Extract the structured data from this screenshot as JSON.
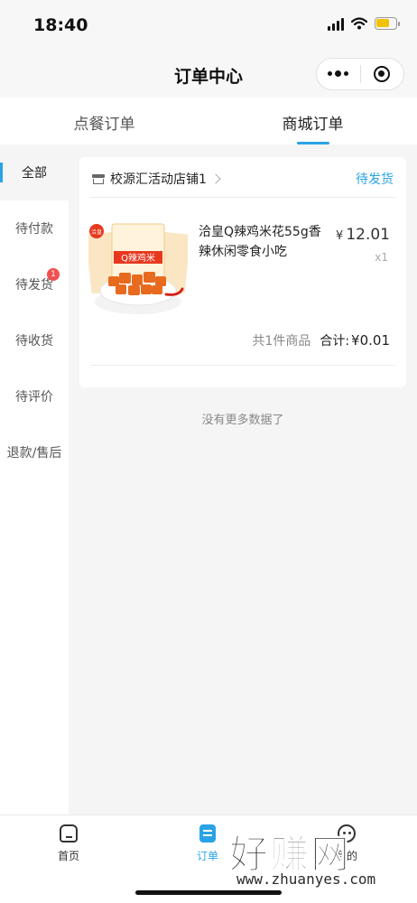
{
  "status_bar": {
    "time": "18:40"
  },
  "nav": {
    "title": "订单中心",
    "more_icon": "more-dots-icon",
    "close_icon": "target-circle-icon"
  },
  "top_tabs": [
    {
      "label": "点餐订单",
      "active": false
    },
    {
      "label": "商城订单",
      "active": true
    }
  ],
  "side_menu": [
    {
      "label": "全部",
      "active": true
    },
    {
      "label": "待付款"
    },
    {
      "label": "待发货",
      "badge": "1"
    },
    {
      "label": "待收货"
    },
    {
      "label": "待评价"
    },
    {
      "label": "退款/售后"
    }
  ],
  "order": {
    "store_name": "校源汇活动店铺1",
    "status": "待发货",
    "product": {
      "name": "洽皇Q辣鸡米花55g香辣休闲零食小吃",
      "price_symbol": "¥",
      "price": "12.01",
      "qty": "x1",
      "package_brand": "洽皇",
      "package_label": "Q辣鸡米"
    },
    "count_text": "共1件商品",
    "total_label": "合计:",
    "total_value": "¥0.01"
  },
  "no_more": "没有更多数据了",
  "bottom_tabs": [
    {
      "label": "首页",
      "icon": "home-icon"
    },
    {
      "label": "订单",
      "icon": "order-icon",
      "active": true
    },
    {
      "label": "我的",
      "icon": "profile-icon"
    }
  ],
  "watermark": {
    "main": "好赚网",
    "sub": "www.zhuanyes.com"
  },
  "colors": {
    "accent": "#2aa3e6",
    "badge": "#f2504f",
    "battery": "#f2c200"
  }
}
